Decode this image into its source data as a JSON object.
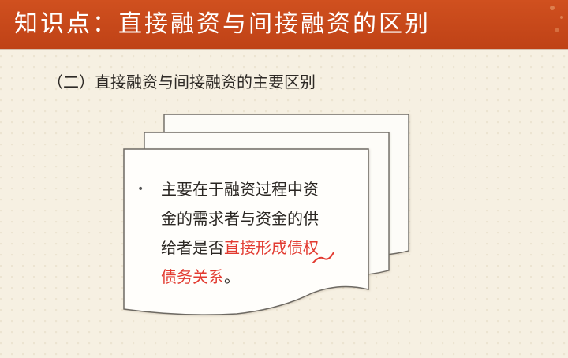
{
  "header": {
    "title": "知识点：直接融资与间接融资的区别"
  },
  "subtitle": "（二）直接融资与间接融资的主要区别",
  "card": {
    "line1": "主要在于融资过程中资",
    "line2": "金的需求者与资金的供",
    "line3_normal": "给者是否",
    "line3_red": "直接形成债权",
    "line4_red": "债务关系",
    "line4_end": "。"
  },
  "colors": {
    "header_bg": "#c6481a",
    "highlight": "#e23a30",
    "background": "#f6f0e2"
  }
}
